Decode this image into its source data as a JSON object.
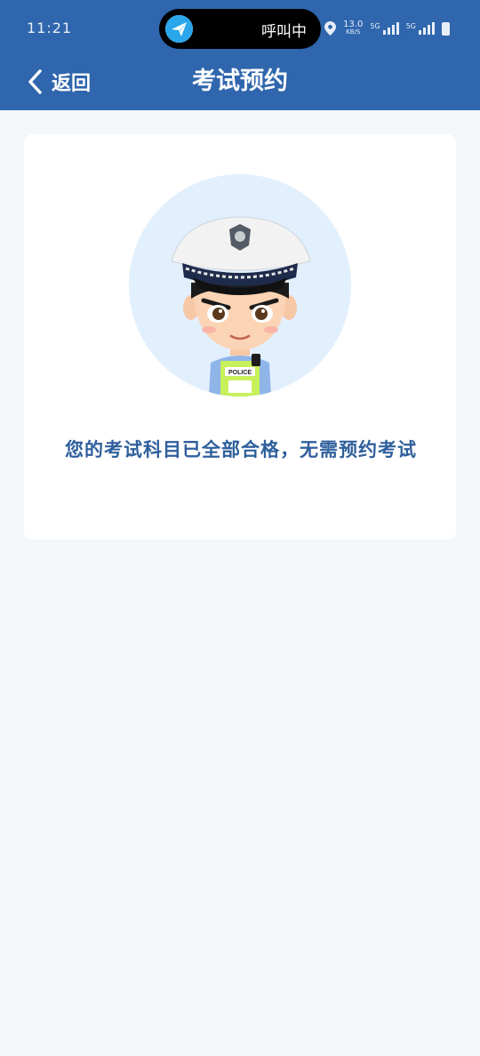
{
  "status_bar": {
    "time": "11:21",
    "call_status": "呼叫中",
    "speed_value": "13.0",
    "speed_unit": "KB/S",
    "network_1": "5G",
    "network_2": "5G"
  },
  "nav": {
    "back_label": "返回",
    "title": "考试预约"
  },
  "card": {
    "badge_text": "POLICE",
    "message": "您的考试科目已全部合格，无需预约考试"
  },
  "colors": {
    "header_bg": "#2f66ad",
    "page_bg": "#f3f7f9",
    "message_text": "#2f5f9c",
    "avatar_bg": "#e2effd"
  }
}
